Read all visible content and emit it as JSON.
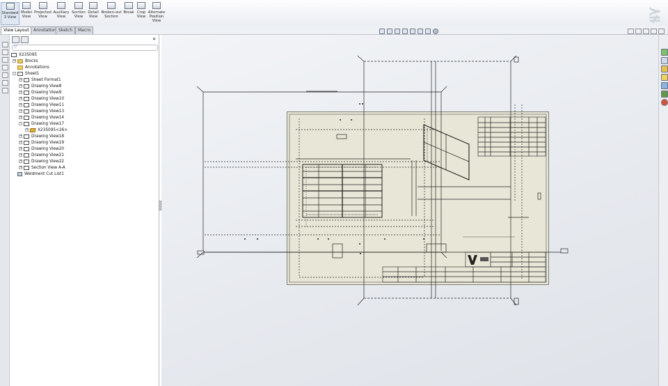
{
  "ribbon": {
    "buttons": [
      {
        "label": "Standard 3 View",
        "icon": "standard-3-view-icon"
      },
      {
        "label": "Model View",
        "icon": "model-view-icon"
      },
      {
        "label": "Projected View",
        "icon": "projected-view-icon"
      },
      {
        "label": "Auxiliary View",
        "icon": "auxiliary-view-icon"
      },
      {
        "label": "Section View",
        "icon": "section-view-icon"
      },
      {
        "label": "Detail View",
        "icon": "detail-view-icon"
      },
      {
        "label": "Broken-out Section",
        "icon": "broken-out-section-icon"
      },
      {
        "label": "Break",
        "icon": "break-icon"
      },
      {
        "label": "Crop View",
        "icon": "crop-view-icon"
      },
      {
        "label": "Alternate Position View",
        "icon": "alternate-position-view-icon"
      }
    ],
    "logo_icon": "solidworks-logo-icon"
  },
  "tabs": [
    "View Layout",
    "Annotation",
    "Sketch",
    "Macro"
  ],
  "active_tab": "View Layout",
  "tree": {
    "root": "X235095",
    "items": [
      {
        "label": "Blocks",
        "icon": "folder-icon"
      },
      {
        "label": "Annotations",
        "icon": "annotations-icon"
      },
      {
        "label": "Sheet1",
        "icon": "sheet-icon"
      },
      {
        "label": "Sheet Format1",
        "icon": "sheet-format-icon"
      },
      {
        "label": "Drawing View8",
        "icon": "drawing-view-icon"
      },
      {
        "label": "Drawing View9",
        "icon": "drawing-view-icon"
      },
      {
        "label": "Drawing View10",
        "icon": "drawing-view-icon"
      },
      {
        "label": "Drawing View11",
        "icon": "drawing-view-icon"
      },
      {
        "label": "Drawing View13",
        "icon": "drawing-view-icon"
      },
      {
        "label": "Drawing View14",
        "icon": "drawing-view-icon"
      },
      {
        "label": "Drawing View17",
        "icon": "drawing-view-icon"
      },
      {
        "label": "X235095<26>",
        "icon": "part-icon"
      },
      {
        "label": "Drawing View18",
        "icon": "drawing-view-icon"
      },
      {
        "label": "Drawing View19",
        "icon": "drawing-view-icon"
      },
      {
        "label": "Drawing View20",
        "icon": "drawing-view-icon"
      },
      {
        "label": "Drawing View21",
        "icon": "drawing-view-icon"
      },
      {
        "label": "Drawing View22",
        "icon": "drawing-view-icon"
      },
      {
        "label": "Section View A-A",
        "icon": "section-view-icon"
      },
      {
        "label": "Weldment Cut List1",
        "icon": "weldment-cut-list-icon"
      }
    ]
  },
  "panel": {
    "collapse_symbol": "»"
  },
  "colors": {
    "ribbon_bg": "#eaedf2",
    "graphics_bg": "#e6e9ee",
    "sheet_bg": "#e8e6d6",
    "accent": "#1f5fbf"
  }
}
